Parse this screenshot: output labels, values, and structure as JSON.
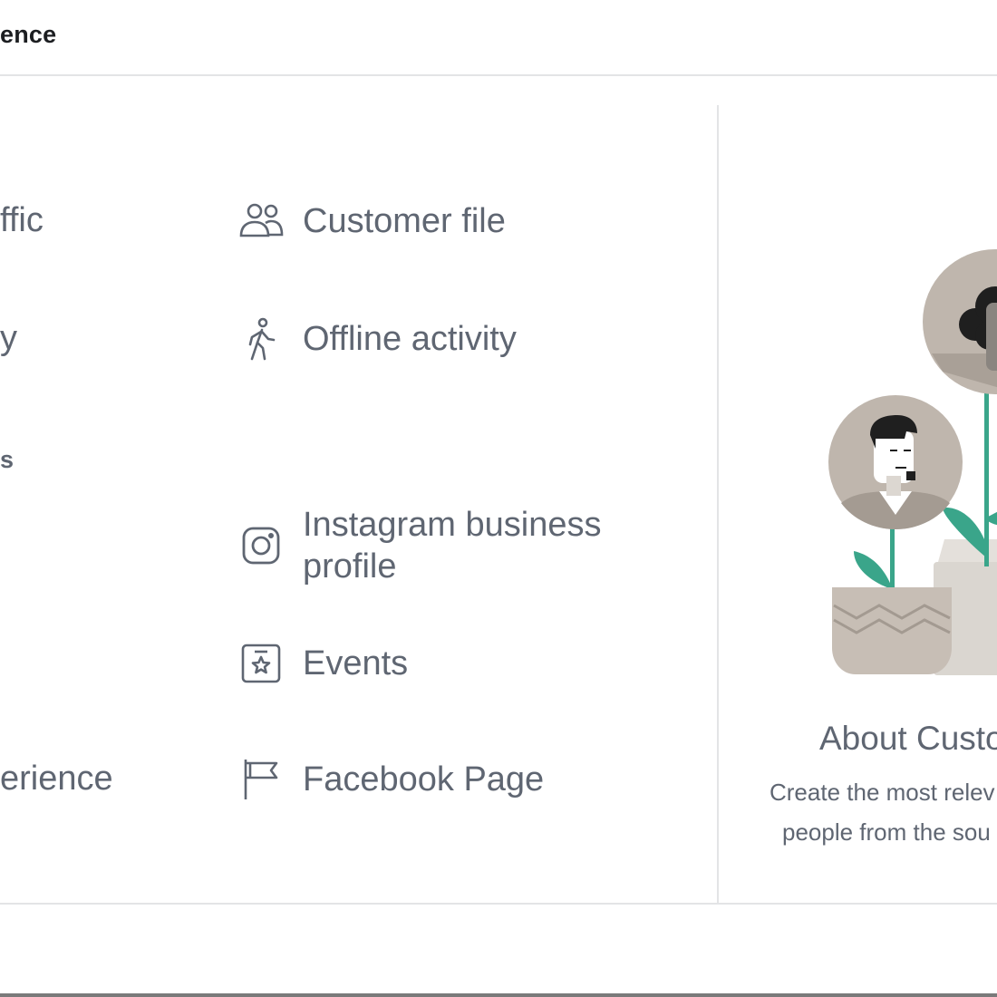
{
  "header": {
    "title": "ence"
  },
  "left_column": {
    "items": [
      {
        "label": "ffic"
      },
      {
        "label": "y"
      },
      {
        "label": "s"
      },
      {
        "label": "erience"
      }
    ]
  },
  "options": [
    {
      "label": "Customer file",
      "icon": "people-icon"
    },
    {
      "label": "Offline activity",
      "icon": "walking-person-icon"
    },
    {
      "label": "Instagram business\nprofile",
      "icon": "instagram-icon"
    },
    {
      "label": "Events",
      "icon": "event-star-icon"
    },
    {
      "label": "Facebook Page",
      "icon": "flag-icon"
    }
  ],
  "side_panel": {
    "title": "About Custo",
    "description_line1": "Create the most relev",
    "description_line2": "people from the sou"
  },
  "colors": {
    "text": "#5f6672",
    "title_text": "#1c1e21",
    "divider": "#e3e4e6",
    "plant_green": "#3aa58a",
    "portrait_bg": "#bfb6ad",
    "pot": "#c7beb5"
  }
}
